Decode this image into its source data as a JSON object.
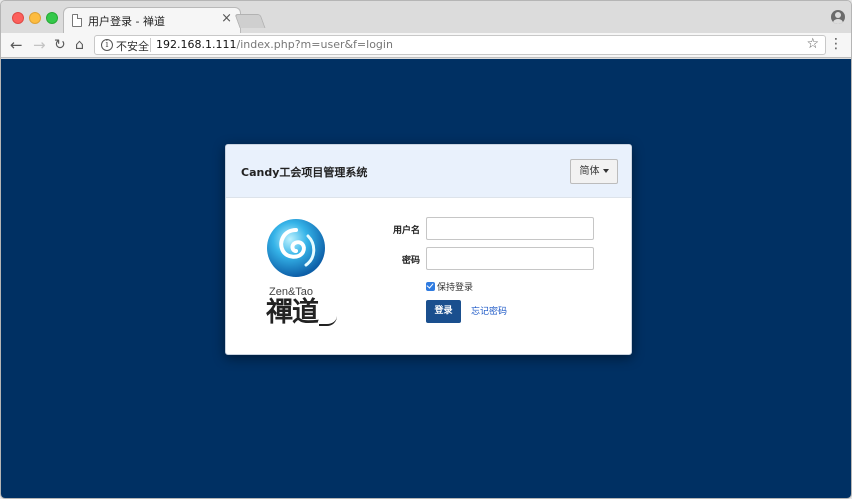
{
  "browser": {
    "tab_title": "用户登录 - 禅道",
    "tab_close": "×",
    "security_label": "不安全",
    "url_host": "192.168.1.111",
    "url_path": "/index.php?m=user&f=login",
    "icons": {
      "back": "back-arrow-icon",
      "forward": "forward-arrow-icon",
      "reload": "reload-icon",
      "home": "home-icon",
      "info": "info-icon",
      "star": "star-icon",
      "menu": "menu-icon",
      "profile": "profile-icon"
    }
  },
  "login": {
    "title": "Candy工会项目管理系统",
    "language_button": "简体",
    "username_label": "用户名",
    "password_label": "密码",
    "username_value": "",
    "password_value": "",
    "remember_label": "保持登录",
    "remember_checked": true,
    "submit_label": "登录",
    "forgot_label": "忘记密码"
  },
  "logo": {
    "en_text": "Zen&Tao",
    "cn_text": "禪道"
  },
  "colors": {
    "page_background": "#003063",
    "panel_header": "#e9f1fc",
    "login_button": "#1a4f8e",
    "link": "#1b57c6",
    "checkbox": "#2f7be0"
  }
}
